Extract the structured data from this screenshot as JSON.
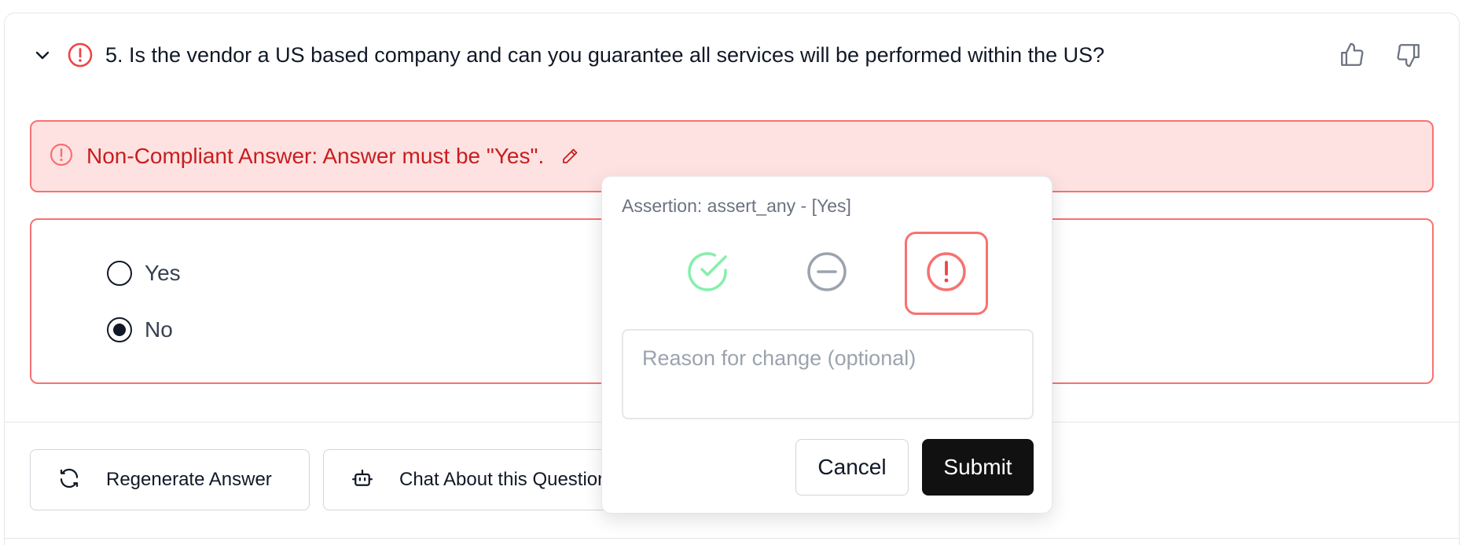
{
  "question": {
    "title": "5. Is the vendor a US based company and can you guarantee all services will be performed within the US?"
  },
  "banner": {
    "message": "Non-Compliant Answer: Answer must be \"Yes\"."
  },
  "answer": {
    "options": [
      {
        "label": "Yes",
        "selected": false
      },
      {
        "label": "No",
        "selected": true
      }
    ]
  },
  "actions": {
    "regenerate_label": "Regenerate Answer",
    "chat_label": "Chat About this Question"
  },
  "popover": {
    "assertion": "Assertion: assert_any - [Yes]",
    "statuses": [
      "pass",
      "neutral",
      "fail"
    ],
    "selected_status": "fail",
    "reason_placeholder": "Reason for change (optional)",
    "cancel_label": "Cancel",
    "submit_label": "Submit"
  },
  "colors": {
    "error": "#ef4444",
    "error_text": "#c81e1e",
    "banner_bg": "#fee2e2",
    "success": "#86efac",
    "neutral": "#9ca3af",
    "primary_button": "#111111"
  }
}
